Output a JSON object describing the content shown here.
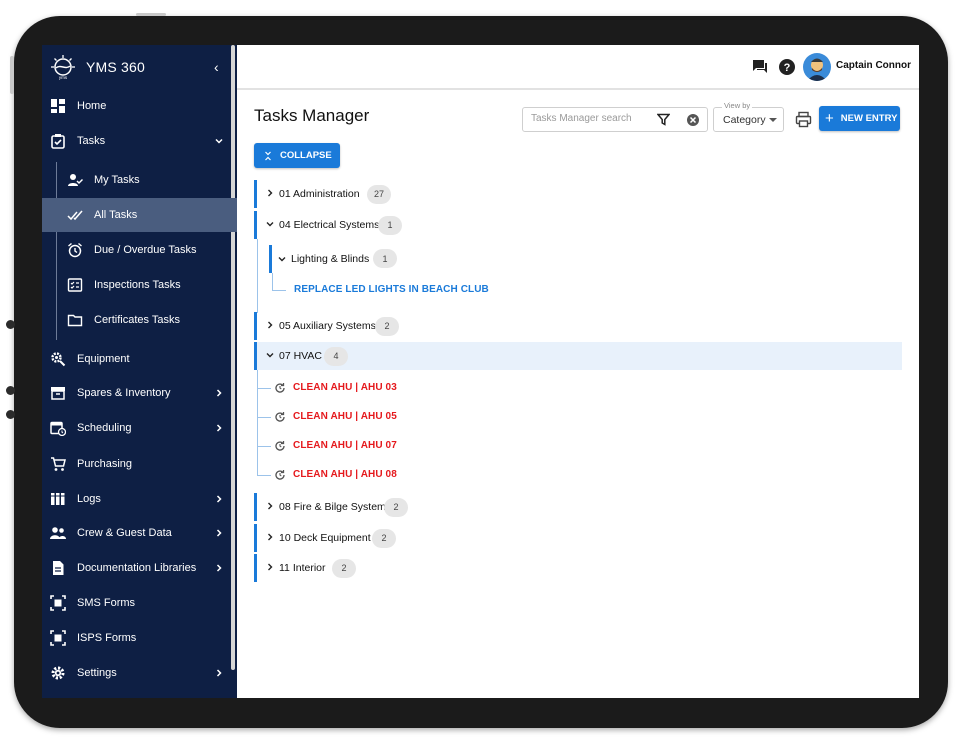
{
  "app": {
    "name": "YMS 360"
  },
  "sidebar": {
    "items": [
      {
        "label": "Home",
        "icon": "dashboard-icon"
      },
      {
        "label": "Tasks",
        "icon": "clipboard-check-icon",
        "expanded": true
      },
      {
        "label": "My Tasks",
        "icon": "user-check-icon"
      },
      {
        "label": "All Tasks",
        "icon": "double-check-icon",
        "active": true
      },
      {
        "label": "Due / Overdue Tasks",
        "icon": "alarm-clock-icon"
      },
      {
        "label": "Inspections Tasks",
        "icon": "checklist-icon"
      },
      {
        "label": "Certificates Tasks",
        "icon": "folder-icon"
      },
      {
        "label": "Equipment",
        "icon": "gear-search-icon"
      },
      {
        "label": "Spares & Inventory",
        "icon": "archive-box-icon"
      },
      {
        "label": "Scheduling",
        "icon": "calendar-clock-icon"
      },
      {
        "label": "Purchasing",
        "icon": "cart-icon"
      },
      {
        "label": "Logs",
        "icon": "books-icon"
      },
      {
        "label": "Crew & Guest Data",
        "icon": "people-icon"
      },
      {
        "label": "Documentation Libraries",
        "icon": "document-icon"
      },
      {
        "label": "SMS Forms",
        "icon": "form-frame-icon"
      },
      {
        "label": "ISPS Forms",
        "icon": "form-frame-icon"
      },
      {
        "label": "Settings",
        "icon": "gear-icon"
      }
    ]
  },
  "topbar": {
    "user_name": "Captain Connor"
  },
  "page": {
    "title": "Tasks Manager",
    "search_placeholder": "Tasks Manager search",
    "view_by_label": "View by",
    "view_by_value": "Category",
    "new_entry_label": "NEW ENTRY",
    "collapse_label": "COLLAPSE"
  },
  "tree": {
    "categories": [
      {
        "label": "01 Administration",
        "count": "27"
      },
      {
        "label": "04 Electrical Systems",
        "count": "1"
      },
      {
        "label": "05 Auxiliary Systems",
        "count": "2"
      },
      {
        "label": "07 HVAC",
        "count": "4"
      },
      {
        "label": "08 Fire & Bilge System",
        "count": "2"
      },
      {
        "label": "10 Deck Equipment",
        "count": "2"
      },
      {
        "label": "11 Interior",
        "count": "2"
      }
    ],
    "subgroup": {
      "label": "Lighting & Blinds",
      "count": "1"
    },
    "subgroup_task": "REPLACE LED LIGHTS IN BEACH CLUB",
    "hvac_tasks": [
      "CLEAN AHU | AHU 03",
      "CLEAN AHU | AHU 05",
      "CLEAN AHU | AHU 07",
      "CLEAN AHU | AHU 08"
    ]
  },
  "colors": {
    "sidebar_bg": "#0e1f44",
    "accent": "#1a7ad9",
    "overdue": "#e5191d",
    "active_item": "#4a5d7f"
  }
}
